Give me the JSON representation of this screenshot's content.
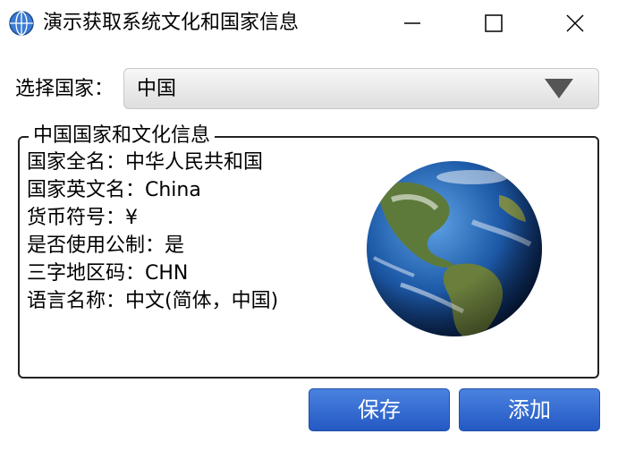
{
  "window": {
    "title": "演示获取系统文化和国家信息",
    "icon": "globe-app-icon",
    "controls": [
      "minimize-icon",
      "maximize-icon",
      "close-icon"
    ]
  },
  "country_select": {
    "label": "选择国家：",
    "selected": "中国"
  },
  "info_group": {
    "title": "中国国家和文化信息",
    "lines": [
      "国家全名：中华人民共和国",
      "国家英文名：China",
      "货币符号：¥",
      "是否使用公制：是",
      "三字地区码：CHN",
      "语言名称：中文(简体，中国)"
    ],
    "image": "earth-globe-image"
  },
  "buttons": {
    "save": "保存",
    "add": "添加"
  },
  "colors": {
    "accent_button": "#2f66cf",
    "combo_background": "#e6e6e6"
  }
}
